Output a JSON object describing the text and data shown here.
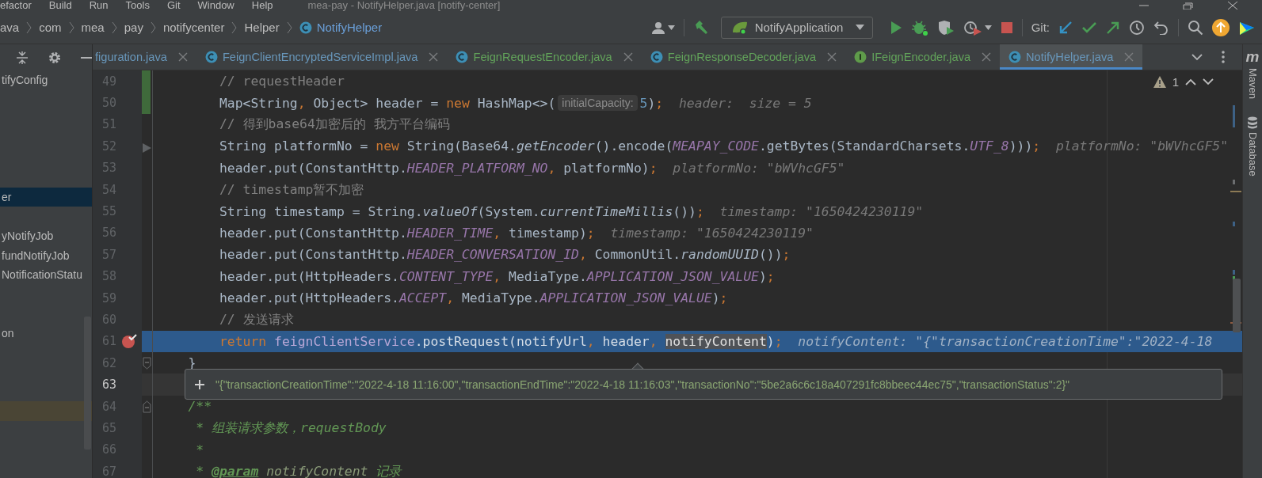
{
  "menu_bar": {
    "items": [
      "efactor",
      "Build",
      "Run",
      "Tools",
      "Git",
      "Window",
      "Help"
    ],
    "title": "mea-pay - NotifyHelper.java [notify-center]"
  },
  "navigation_bar": {
    "breadcrumbs": [
      {
        "label": "ava",
        "selected": false
      },
      {
        "label": "com",
        "selected": false
      },
      {
        "label": "mea",
        "selected": false
      },
      {
        "label": "pay",
        "selected": false
      },
      {
        "label": "notifycenter",
        "selected": false
      },
      {
        "label": "Helper",
        "selected": false
      },
      {
        "label": "NotifyHelper",
        "kind": "class",
        "selected": true
      }
    ],
    "run_configuration": "NotifyApplication",
    "git_label": "Git:"
  },
  "project_tree": {
    "items": [
      {
        "label": "tifyConfig",
        "selected": false
      },
      {
        "label": "er",
        "selected": true
      },
      {
        "label": "yNotifyJob",
        "selected": false
      },
      {
        "label": "fundNotifyJob",
        "selected": false
      },
      {
        "label": "NotificationStatu",
        "selected": false
      },
      {
        "label": "on",
        "selected": false
      }
    ]
  },
  "editor_tabs": [
    {
      "label": "figuration.java",
      "color": "#6897bb",
      "selected": false
    },
    {
      "label": "FeignClientEncryptedServiceImpl.java",
      "kind": "class",
      "color": "#6897bb",
      "selected": false
    },
    {
      "label": "FeignRequestEncoder.java",
      "kind": "class",
      "color": "#62a35a",
      "selected": false
    },
    {
      "label": "FeignResponseDecoder.java",
      "kind": "class",
      "color": "#62a35a",
      "selected": false
    },
    {
      "label": "IFeignEncoder.java",
      "kind": "interface",
      "color": "#62a35a",
      "selected": false
    },
    {
      "label": "NotifyHelper.java",
      "kind": "class",
      "color": "#6897bb",
      "selected": true
    }
  ],
  "editor": {
    "problems_count": "1",
    "lines": [
      {
        "number": "49",
        "changed": true,
        "breakpoint": false,
        "highlighted": false,
        "current": false,
        "arrow_mark": false,
        "fold_start": false,
        "fold_end": false,
        "code": [
          {
            "text": "        // requestHeader",
            "kind": "comment"
          }
        ]
      },
      {
        "number": "50",
        "changed": true,
        "breakpoint": false,
        "highlighted": false,
        "current": false,
        "arrow_mark": false,
        "fold_start": false,
        "fold_end": false,
        "code": [
          {
            "text": "        Map<String",
            "kind": "plain"
          },
          {
            "text": ",",
            "kind": "keyword"
          },
          {
            "text": " Object> header =",
            "kind": "plain"
          },
          {
            "text": " new",
            "kind": "keyword"
          },
          {
            "text": " HashMap<>(",
            "kind": "plain"
          },
          {
            "text": "initialCapacity:",
            "kind": "inlay"
          },
          {
            "text": "5",
            "kind": "number"
          },
          {
            "text": ")",
            "kind": "plain"
          },
          {
            "text": ";",
            "kind": "keyword"
          }
        ],
        "value": "header:  size = 5"
      },
      {
        "number": "51",
        "changed": false,
        "breakpoint": false,
        "highlighted": false,
        "current": false,
        "arrow_mark": false,
        "fold_start": false,
        "fold_end": false,
        "code": [
          {
            "text": "        // 得到base64加密后的 我方平台编码",
            "kind": "comment"
          }
        ]
      },
      {
        "number": "52",
        "changed": false,
        "breakpoint": false,
        "highlighted": false,
        "current": false,
        "arrow_mark": true,
        "fold_start": false,
        "fold_end": false,
        "code": [
          {
            "text": "        String platformNo =",
            "kind": "plain"
          },
          {
            "text": " new",
            "kind": "keyword"
          },
          {
            "text": " String(Base64.",
            "kind": "plain"
          },
          {
            "text": "getEncoder",
            "kind": "italic"
          },
          {
            "text": "().encode(",
            "kind": "plain"
          },
          {
            "text": "MEAPAY_CODE",
            "kind": "constant"
          },
          {
            "text": ".getBytes(StandardCharsets.",
            "kind": "plain"
          },
          {
            "text": "UTF_8",
            "kind": "constant"
          },
          {
            "text": ")))",
            "kind": "plain"
          },
          {
            "text": ";",
            "kind": "keyword"
          }
        ],
        "value": "platformNo: \"bWVhcGF5\""
      },
      {
        "number": "53",
        "changed": false,
        "breakpoint": false,
        "highlighted": false,
        "current": false,
        "arrow_mark": false,
        "fold_start": false,
        "fold_end": false,
        "code": [
          {
            "text": "        header.put(ConstantHttp.",
            "kind": "plain"
          },
          {
            "text": "HEADER_PLATFORM_NO",
            "kind": "constant"
          },
          {
            "text": ",",
            "kind": "keyword"
          },
          {
            "text": " platformNo)",
            "kind": "plain"
          },
          {
            "text": ";",
            "kind": "keyword"
          }
        ],
        "value": "platformNo: \"bWVhcGF5\""
      },
      {
        "number": "54",
        "changed": false,
        "breakpoint": false,
        "highlighted": false,
        "current": false,
        "arrow_mark": false,
        "fold_start": false,
        "fold_end": false,
        "code": [
          {
            "text": "        // timestamp暂不加密",
            "kind": "comment"
          }
        ]
      },
      {
        "number": "55",
        "changed": false,
        "breakpoint": false,
        "highlighted": false,
        "current": false,
        "arrow_mark": false,
        "fold_start": false,
        "fold_end": false,
        "code": [
          {
            "text": "        String timestamp = String.",
            "kind": "plain"
          },
          {
            "text": "valueOf",
            "kind": "italic"
          },
          {
            "text": "(System.",
            "kind": "plain"
          },
          {
            "text": "currentTimeMillis",
            "kind": "italic"
          },
          {
            "text": "())",
            "kind": "plain"
          },
          {
            "text": ";",
            "kind": "keyword"
          }
        ],
        "value": "timestamp: \"1650424230119\""
      },
      {
        "number": "56",
        "changed": false,
        "breakpoint": false,
        "highlighted": false,
        "current": false,
        "arrow_mark": false,
        "fold_start": false,
        "fold_end": false,
        "code": [
          {
            "text": "        header.put(ConstantHttp.",
            "kind": "plain"
          },
          {
            "text": "HEADER_TIME",
            "kind": "constant"
          },
          {
            "text": ",",
            "kind": "keyword"
          },
          {
            "text": " timestamp)",
            "kind": "plain"
          },
          {
            "text": ";",
            "kind": "keyword"
          }
        ],
        "value": "timestamp: \"1650424230119\""
      },
      {
        "number": "57",
        "changed": false,
        "breakpoint": false,
        "highlighted": false,
        "current": false,
        "arrow_mark": false,
        "fold_start": false,
        "fold_end": false,
        "code": [
          {
            "text": "        header.put(ConstantHttp.",
            "kind": "plain"
          },
          {
            "text": "HEADER_CONVERSATION_ID",
            "kind": "constant"
          },
          {
            "text": ",",
            "kind": "keyword"
          },
          {
            "text": " CommonUtil.",
            "kind": "plain"
          },
          {
            "text": "randomUUID",
            "kind": "italic"
          },
          {
            "text": "())",
            "kind": "plain"
          },
          {
            "text": ";",
            "kind": "keyword"
          }
        ]
      },
      {
        "number": "58",
        "changed": false,
        "breakpoint": false,
        "highlighted": false,
        "current": false,
        "arrow_mark": false,
        "fold_start": false,
        "fold_end": false,
        "code": [
          {
            "text": "        header.put(HttpHeaders.",
            "kind": "plain"
          },
          {
            "text": "CONTENT_TYPE",
            "kind": "constant"
          },
          {
            "text": ",",
            "kind": "keyword"
          },
          {
            "text": " MediaType.",
            "kind": "plain"
          },
          {
            "text": "APPLICATION_JSON_VALUE",
            "kind": "constant"
          },
          {
            "text": ")",
            "kind": "plain"
          },
          {
            "text": ";",
            "kind": "keyword"
          }
        ]
      },
      {
        "number": "59",
        "changed": false,
        "breakpoint": false,
        "highlighted": false,
        "current": false,
        "arrow_mark": false,
        "fold_start": false,
        "fold_end": false,
        "code": [
          {
            "text": "        header.put(HttpHeaders.",
            "kind": "plain"
          },
          {
            "text": "ACCEPT",
            "kind": "constant"
          },
          {
            "text": ",",
            "kind": "keyword"
          },
          {
            "text": " MediaType.",
            "kind": "plain"
          },
          {
            "text": "APPLICATION_JSON_VALUE",
            "kind": "constant"
          },
          {
            "text": ")",
            "kind": "plain"
          },
          {
            "text": ";",
            "kind": "keyword"
          }
        ]
      },
      {
        "number": "60",
        "changed": false,
        "breakpoint": false,
        "highlighted": false,
        "current": false,
        "arrow_mark": false,
        "fold_start": false,
        "fold_end": false,
        "code": [
          {
            "text": "        // 发送请求",
            "kind": "comment"
          }
        ]
      },
      {
        "number": "61",
        "changed": false,
        "breakpoint": true,
        "highlighted": true,
        "current": false,
        "arrow_mark": false,
        "fold_start": false,
        "fold_end": false,
        "code": [
          {
            "text": "        return",
            "kind": "keyword"
          },
          {
            "text": " feignClientService",
            "kind": "field"
          },
          {
            "text": ".postRequest(notifyUrl",
            "kind": "plain"
          },
          {
            "text": ",",
            "kind": "keyword"
          },
          {
            "text": " header",
            "kind": "plain"
          },
          {
            "text": ",",
            "kind": "keyword"
          },
          {
            "text": " notifyContent",
            "kind": "hover"
          },
          {
            "text": ")",
            "kind": "plain"
          },
          {
            "text": ";",
            "kind": "keyword"
          }
        ],
        "value": "notifyContent: \"{\"transactionCreationTime\":\"2022-4-18"
      },
      {
        "number": "62",
        "changed": false,
        "breakpoint": false,
        "highlighted": false,
        "current": false,
        "arrow_mark": false,
        "fold_start": false,
        "fold_end": true,
        "code": [
          {
            "text": "    }",
            "kind": "plain"
          }
        ]
      },
      {
        "number": "63",
        "changed": false,
        "breakpoint": false,
        "highlighted": false,
        "current": true,
        "arrow_mark": false,
        "fold_start": false,
        "fold_end": false
      },
      {
        "number": "64",
        "changed": false,
        "breakpoint": false,
        "highlighted": false,
        "current": false,
        "arrow_mark": false,
        "fold_start": true,
        "fold_end": false,
        "code": [
          {
            "text": "    /**",
            "kind": "doc"
          }
        ]
      },
      {
        "number": "65",
        "changed": false,
        "breakpoint": false,
        "highlighted": false,
        "current": false,
        "arrow_mark": false,
        "fold_start": false,
        "fold_end": false,
        "code": [
          {
            "text": "     * 组装请求参数，requestBody",
            "kind": "doc"
          }
        ]
      },
      {
        "number": "66",
        "changed": false,
        "breakpoint": false,
        "highlighted": false,
        "current": false,
        "arrow_mark": false,
        "fold_start": false,
        "fold_end": false,
        "code": [
          {
            "text": "     *",
            "kind": "doc"
          }
        ]
      },
      {
        "number": "67",
        "changed": false,
        "breakpoint": false,
        "highlighted": false,
        "current": false,
        "arrow_mark": false,
        "fold_start": false,
        "fold_end": false,
        "code": [
          {
            "text": "     *",
            "kind": "doc"
          },
          {
            "text": " @param",
            "kind": "doc-tag"
          },
          {
            "text": " notifyContent",
            "kind": "doc-param"
          },
          {
            "text": " 记录",
            "kind": "doc"
          }
        ]
      }
    ],
    "value_popup": {
      "text": "\"{\"transactionCreationTime\":\"2022-4-18 11:16:00\",\"transactionEndTime\":\"2022-4-18 11:16:03\",\"transactionNo\":\"5be2a6c6c18a407291fc8bbeec44ec75\",\"transactionStatus\":2}\""
    }
  },
  "right_tool_strip": [
    {
      "kind": "letter",
      "glyph": "m",
      "label": "Maven"
    },
    {
      "kind": "database",
      "label": "Database"
    }
  ]
}
